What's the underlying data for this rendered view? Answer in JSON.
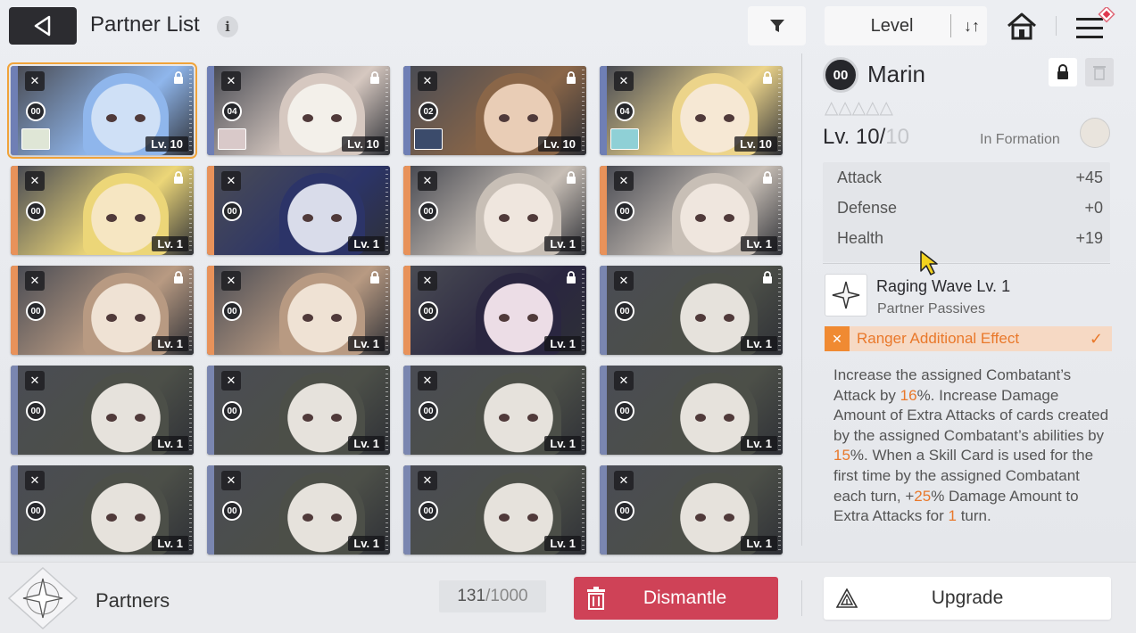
{
  "header": {
    "title": "Partner List",
    "info_glyph": "i",
    "sort_label": "Level",
    "sort_glyph": "↓↑"
  },
  "cards": [
    {
      "badge": "00",
      "level": "Lv. 10",
      "stripe": "#6f7fb5",
      "face": "#cfe0f6",
      "hair": "#8fb6ec",
      "selected": true,
      "thumb": "#dfe6d6",
      "locked": true
    },
    {
      "badge": "04",
      "level": "Lv. 10",
      "stripe": "#6f7fb5",
      "face": "#f3f0ea",
      "hair": "#d6c8c0",
      "selected": false,
      "thumb": "#d9c9c9",
      "locked": true
    },
    {
      "badge": "02",
      "level": "Lv. 10",
      "stripe": "#6f7fb5",
      "face": "#e9cdb6",
      "hair": "#8a6648",
      "selected": false,
      "thumb": "#3b4b6b",
      "locked": true
    },
    {
      "badge": "04",
      "level": "Lv. 10",
      "stripe": "#6f7fb5",
      "face": "#f6e8d4",
      "hair": "#ecd48a",
      "selected": false,
      "thumb": "#8fd0d6",
      "locked": true
    },
    {
      "badge": "00",
      "level": "Lv. 1",
      "stripe": "#e8925a",
      "face": "#f6e6c2",
      "hair": "#ecd678",
      "selected": false,
      "thumb": null,
      "locked": true
    },
    {
      "badge": "00",
      "level": "Lv. 1",
      "stripe": "#e8925a",
      "face": "#d9dcea",
      "hair": "#2c3468",
      "selected": false,
      "thumb": null,
      "locked": false
    },
    {
      "badge": "00",
      "level": "Lv. 1",
      "stripe": "#e8925a",
      "face": "#efe6de",
      "hair": "#c8bfb6",
      "selected": false,
      "thumb": null,
      "locked": true
    },
    {
      "badge": "00",
      "level": "Lv. 1",
      "stripe": "#e8925a",
      "face": "#efe6de",
      "hair": "#c8bfb6",
      "selected": false,
      "thumb": null,
      "locked": true
    },
    {
      "badge": "00",
      "level": "Lv. 1",
      "stripe": "#e8925a",
      "face": "#efe2d4",
      "hair": "#b89a82",
      "selected": false,
      "thumb": null,
      "locked": true
    },
    {
      "badge": "00",
      "level": "Lv. 1",
      "stripe": "#e8925a",
      "face": "#efe2d4",
      "hair": "#b89a82",
      "selected": false,
      "thumb": null,
      "locked": true
    },
    {
      "badge": "00",
      "level": "Lv. 1",
      "stripe": "#e8925a",
      "face": "#ecdde6",
      "hair": "#2a2640",
      "selected": false,
      "thumb": null,
      "locked": true
    },
    {
      "badge": "00",
      "level": "Lv. 1",
      "stripe": "#7a86b0",
      "face": "#e6e2dc",
      "hair": "#4c4f48",
      "selected": false,
      "thumb": null,
      "locked": true
    },
    {
      "badge": "00",
      "level": "Lv. 1",
      "stripe": "#7a86b0",
      "face": "#e6e2dc",
      "hair": "#4c4f48",
      "selected": false,
      "thumb": null,
      "locked": false
    },
    {
      "badge": "00",
      "level": "Lv. 1",
      "stripe": "#7a86b0",
      "face": "#e6e2dc",
      "hair": "#4c4f48",
      "selected": false,
      "thumb": null,
      "locked": false
    },
    {
      "badge": "00",
      "level": "Lv. 1",
      "stripe": "#7a86b0",
      "face": "#e6e2dc",
      "hair": "#4c4f48",
      "selected": false,
      "thumb": null,
      "locked": false
    },
    {
      "badge": "00",
      "level": "Lv. 1",
      "stripe": "#7a86b0",
      "face": "#e6e2dc",
      "hair": "#4c4f48",
      "selected": false,
      "thumb": null,
      "locked": false
    },
    {
      "badge": "00",
      "level": "Lv. 1",
      "stripe": "#7a86b0",
      "face": "#e6e2dc",
      "hair": "#4c4f48",
      "selected": false,
      "thumb": null,
      "locked": false
    },
    {
      "badge": "00",
      "level": "Lv. 1",
      "stripe": "#7a86b0",
      "face": "#e6e2dc",
      "hair": "#4c4f48",
      "selected": false,
      "thumb": null,
      "locked": false
    },
    {
      "badge": "00",
      "level": "Lv. 1",
      "stripe": "#7a86b0",
      "face": "#e6e2dc",
      "hair": "#4c4f48",
      "selected": false,
      "thumb": null,
      "locked": false
    },
    {
      "badge": "00",
      "level": "Lv. 1",
      "stripe": "#7a86b0",
      "face": "#e6e2dc",
      "hair": "#4c4f48",
      "selected": false,
      "thumb": null,
      "locked": false
    }
  ],
  "detail": {
    "badge": "00",
    "name": "Marin",
    "stars": "△△△△△",
    "level_current": "Lv. 10/",
    "level_max": "10",
    "formation_label": "In Formation",
    "stats": [
      {
        "label": "Attack",
        "value": "+45"
      },
      {
        "label": "Defense",
        "value": "+0"
      },
      {
        "label": "Health",
        "value": "+19"
      }
    ],
    "skill_name": "Raging Wave Lv. 1",
    "skill_type": "Partner Passives",
    "effect_label": "Ranger Additional Effect",
    "effect_check": "✓",
    "description": [
      {
        "t": "Increase the assigned Combatant’s Attack by "
      },
      {
        "t": "16",
        "hl": true
      },
      {
        "t": "%. Increase Damage Amount of Extra Attacks of cards created by the assigned Combatant’s abilities by "
      },
      {
        "t": "15",
        "hl": true
      },
      {
        "t": "%. When a Skill Card is used for the first time by the assigned Combatant each turn, +"
      },
      {
        "t": "25",
        "hl": true
      },
      {
        "t": "% Damage Amount to Extra Attacks for "
      },
      {
        "t": "1",
        "hl": true
      },
      {
        "t": " turn."
      }
    ]
  },
  "footer": {
    "title": "Partners",
    "count": "131",
    "count_sep": " / ",
    "capacity": "1000",
    "dismantle_label": "Dismantle",
    "upgrade_label": "Upgrade"
  },
  "colors": {
    "accent_orange": "#e9782a",
    "dismantle_red": "#cf4257",
    "selected_outline": "#f0a33a"
  }
}
